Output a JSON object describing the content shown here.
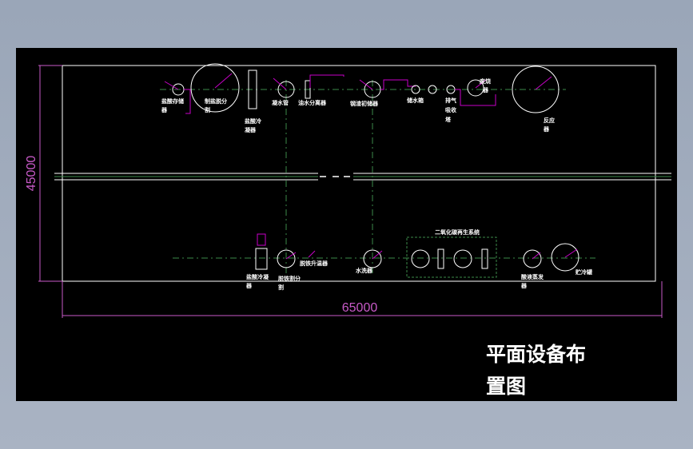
{
  "drawing": {
    "title_line1": "平面设备布",
    "title_line2": "置图",
    "dimension_width": "65000",
    "dimension_height": "45000",
    "top_row_labels": {
      "l1a": "盐酸存储",
      "l1b": "器",
      "l2a": "制盐脱分",
      "l2b": "割",
      "l3a": "盐酸冷",
      "l3b": "凝器",
      "l4": "凝水管",
      "l5": "油水分离器",
      "l6": "钢渣初储器",
      "l7": "储水箱",
      "l8a": "排气",
      "l8b": "吸收",
      "l8c": "塔",
      "l9a": "废烧",
      "l9b": "器",
      "l10a": "反应",
      "l10b": "器"
    },
    "bottom_row_labels": {
      "b1a": "盐酸冷凝",
      "b1b": "器",
      "b2a": "脱铁割分",
      "b2b": "割",
      "b3": "脱铁升温器",
      "b4": "水洗器",
      "b5": "二氧化碳再生系统",
      "b6a": "酸液蒸发",
      "b6b": "器",
      "b7": "贮冷罐"
    },
    "colors": {
      "background": "#000000",
      "outline": "#ffffff",
      "dimension": "#c85ac8",
      "centerline": "#3c8a4a",
      "pipe": "#c800c8"
    }
  }
}
